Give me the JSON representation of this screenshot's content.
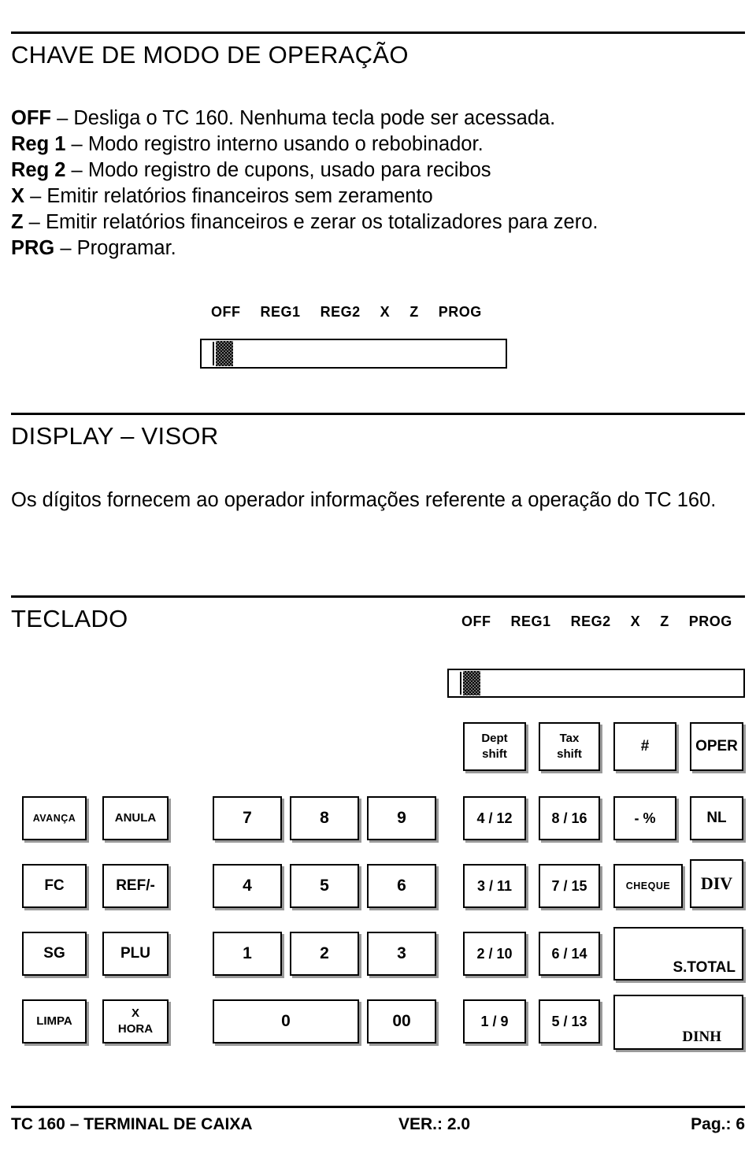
{
  "sections": {
    "mode_key": {
      "title": "CHAVE DE MODO DE OPERAÇÃO",
      "items": [
        {
          "key": "OFF",
          "dash": "–",
          "text": "Desliga o TC 160. Nenhuma tecla pode ser acessada."
        },
        {
          "key": "Reg 1",
          "dash": "–",
          "text": "Modo registro interno usando o rebobinador."
        },
        {
          "key": "Reg 2",
          "dash": "–",
          "text": "Modo registro de cupons, usado para recibos"
        },
        {
          "key": "X",
          "dash": "–",
          "text": "Emitir relatórios financeiros sem zeramento"
        },
        {
          "key": "Z",
          "dash": "–",
          "text": "Emitir relatórios financeiros e zerar os totalizadores para zero."
        },
        {
          "key": "PRG",
          "dash": "–",
          "text": "Programar."
        }
      ],
      "switch_labels": [
        "OFF",
        "REG1",
        "REG2",
        "X",
        "Z",
        "PROG"
      ]
    },
    "display": {
      "title": "DISPLAY – VISOR",
      "text": "Os dígitos fornecem ao operador informações referente a operação do TC 160."
    },
    "keyboard": {
      "title": "TECLADO",
      "switch_labels": [
        "OFF",
        "REG1",
        "REG2",
        "X",
        "Z",
        "PROG"
      ],
      "top_row": [
        {
          "name": "dept-shift",
          "line1": "Dept",
          "line2": "shift"
        },
        {
          "name": "tax-shift",
          "line1": "Tax",
          "line2": "shift"
        },
        {
          "name": "hash",
          "line1": "#",
          "line2": ""
        },
        {
          "name": "oper",
          "line1": "OPER",
          "line2": ""
        }
      ],
      "rows": [
        [
          {
            "name": "avanca",
            "label": "AVANÇA"
          },
          {
            "name": "anula",
            "label": "ANULA"
          },
          {
            "name": "num-7",
            "label": "7"
          },
          {
            "name": "num-8",
            "label": "8"
          },
          {
            "name": "num-9",
            "label": "9"
          },
          {
            "name": "dept-4-12",
            "label": "4 / 12"
          },
          {
            "name": "dept-8-16",
            "label": "8 / 16"
          },
          {
            "name": "percent",
            "label": "- %"
          },
          {
            "name": "nl",
            "label": "NL"
          }
        ],
        [
          {
            "name": "fc",
            "label": "FC"
          },
          {
            "name": "ref-minus",
            "label": "REF/-"
          },
          {
            "name": "num-4",
            "label": "4"
          },
          {
            "name": "num-5",
            "label": "5"
          },
          {
            "name": "num-6",
            "label": "6"
          },
          {
            "name": "dept-3-11",
            "label": "3 / 11"
          },
          {
            "name": "dept-7-15",
            "label": "7 / 15"
          },
          {
            "name": "cheque",
            "label": "CHEQUE"
          },
          {
            "name": "div",
            "label": "DIV"
          }
        ],
        [
          {
            "name": "sg",
            "label": "SG"
          },
          {
            "name": "plu",
            "label": "PLU"
          },
          {
            "name": "num-1",
            "label": "1"
          },
          {
            "name": "num-2",
            "label": "2"
          },
          {
            "name": "num-3",
            "label": "3"
          },
          {
            "name": "dept-2-10",
            "label": "2 / 10"
          },
          {
            "name": "dept-6-14",
            "label": "6 / 14"
          },
          {
            "name": "subtotal",
            "label": "S.TOTAL"
          }
        ],
        [
          {
            "name": "limpa",
            "label": "LIMPA"
          },
          {
            "name": "x-hora-line1",
            "label": "X"
          },
          {
            "name": "x-hora-line2",
            "label": "HORA"
          },
          {
            "name": "num-0",
            "label": "0"
          },
          {
            "name": "num-00",
            "label": "00"
          },
          {
            "name": "dept-1-9",
            "label": "1 / 9"
          },
          {
            "name": "dept-5-13",
            "label": "5 / 13"
          },
          {
            "name": "dinheiro",
            "label": "DINH"
          }
        ]
      ]
    }
  },
  "footer": {
    "left": "TC 160 – TERMINAL DE CAIXA",
    "middle": "VER.: 2.0",
    "right": "Pag.:  6"
  }
}
